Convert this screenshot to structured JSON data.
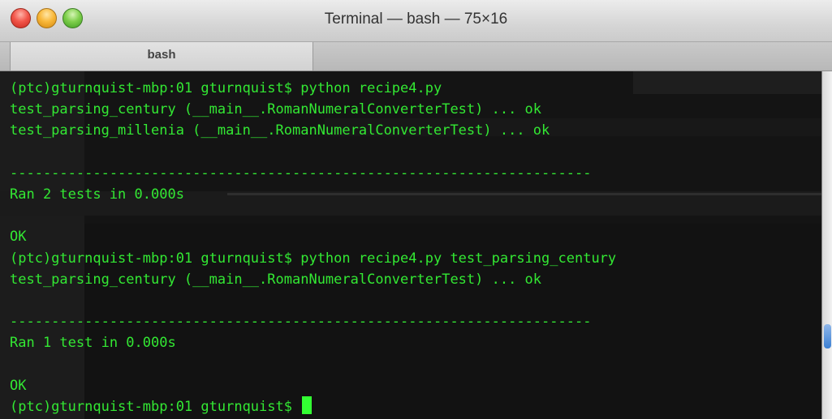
{
  "window": {
    "title": "Terminal — bash — 75×16",
    "tab_label": "bash",
    "buttons": {
      "close_icon": "close-icon",
      "minimize_icon": "minimize-icon",
      "zoom_icon": "zoom-icon"
    },
    "colors": {
      "close": "#f2564a",
      "minimize": "#f9b83a",
      "zoom": "#7fcf4c"
    }
  },
  "terminal": {
    "background": "#141414",
    "text_color": "#33e833",
    "lines": [
      "(ptc)gturnquist-mbp:01 gturnquist$ python recipe4.py",
      "test_parsing_century (__main__.RomanNumeralConverterTest) ... ok",
      "test_parsing_millenia (__main__.RomanNumeralConverterTest) ... ok",
      "",
      "----------------------------------------------------------------------",
      "Ran 2 tests in 0.000s",
      "",
      "OK",
      "(ptc)gturnquist-mbp:01 gturnquist$ python recipe4.py test_parsing_century",
      "test_parsing_century (__main__.RomanNumeralConverterTest) ... ok",
      "",
      "----------------------------------------------------------------------",
      "Ran 1 test in 0.000s",
      "",
      "OK",
      "(ptc)gturnquist-mbp:01 gturnquist$ "
    ]
  }
}
